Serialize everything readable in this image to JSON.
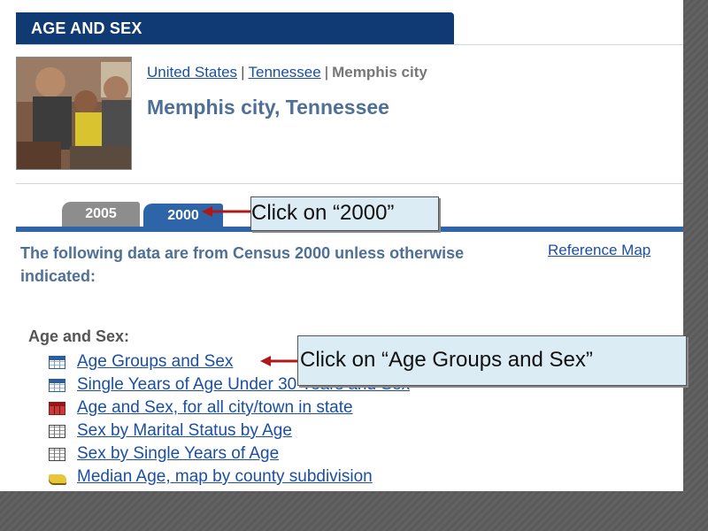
{
  "header": {
    "title": "AGE AND SEX"
  },
  "breadcrumb": {
    "items": [
      "United States",
      "Tennessee"
    ],
    "separator": "|",
    "current": "Memphis city"
  },
  "place": {
    "title": "Memphis city, Tennessee"
  },
  "tabs": [
    {
      "label": "2005",
      "active": false
    },
    {
      "label": "2000",
      "active": true
    }
  ],
  "intro": {
    "text": "The following data are from Census 2000 unless otherwise indicated:"
  },
  "reference_map": {
    "label": "Reference Map"
  },
  "section": {
    "label": "Age and Sex:",
    "links": [
      {
        "label": "Age Groups and Sex",
        "icon": "table-icon"
      },
      {
        "label": "Single Years of Age Under 30 Years and Sex",
        "icon": "table-icon"
      },
      {
        "label": "Age and Sex, for all city/town in state",
        "icon": "red-table-icon"
      },
      {
        "label": "Sex by Marital Status by Age",
        "icon": "plain-table-icon"
      },
      {
        "label": "Sex by Single Years of Age",
        "icon": "plain-table-icon"
      },
      {
        "label": "Median Age, map by county subdivision",
        "icon": "map-icon"
      }
    ]
  },
  "callouts": {
    "tab": "Click on “2000”",
    "link": "Click on “Age Groups and Sex”"
  },
  "colors": {
    "header_bg": "#0f3a73",
    "tab_active": "#2e64a8",
    "tab_inactive": "#8d8d8d",
    "link": "#1b4fa3",
    "heading": "#4f7096",
    "callout_bg": "#dcecf4",
    "arrow": "#b01818"
  }
}
